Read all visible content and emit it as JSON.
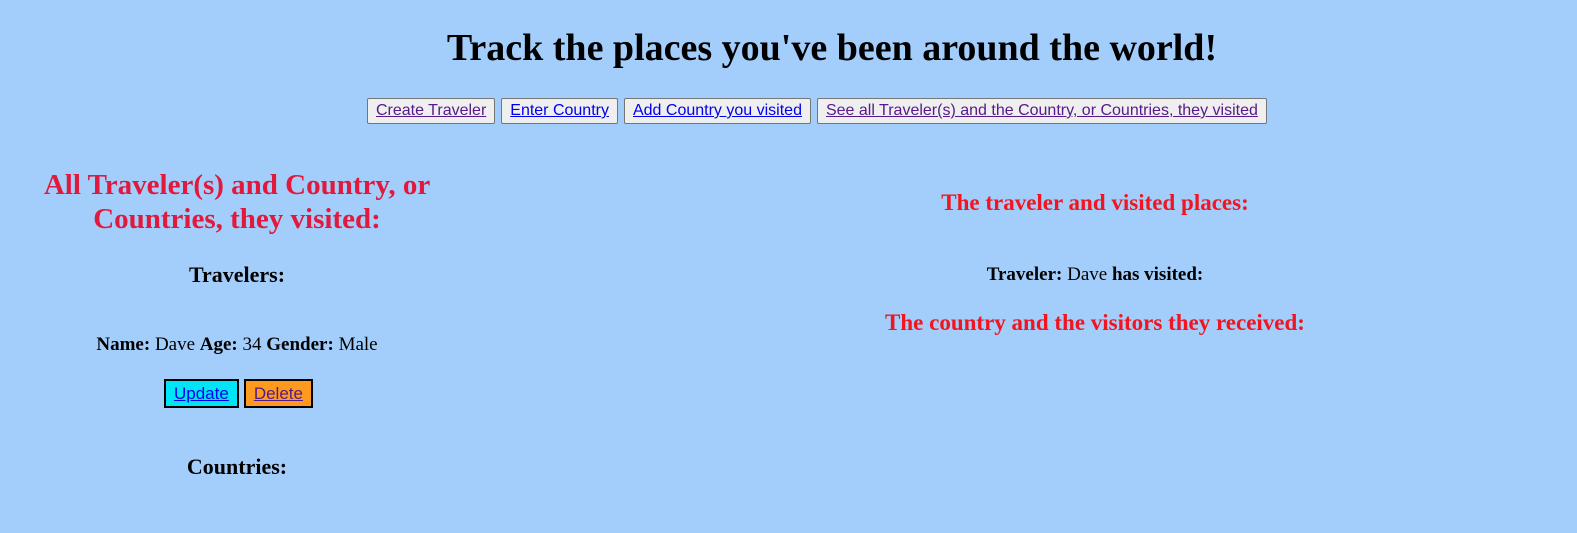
{
  "header": {
    "title": "Track the places you've been around the world!"
  },
  "nav": {
    "create_traveler": "Create Traveler",
    "enter_country": "Enter Country",
    "add_country_visited": "Add Country you visited",
    "see_all": "See all Traveler(s) and the Country, or Countries, they visited"
  },
  "left": {
    "title_line1": "All Traveler(s) and Country, or",
    "title_line2": "Countries, they visited:",
    "travelers_heading": "Travelers:",
    "traveler": {
      "name_label": "Name:",
      "name": "Dave",
      "age_label": "Age:",
      "age": "34",
      "gender_label": "Gender:",
      "gender": "Male"
    },
    "update_label": "Update",
    "delete_label": "Delete",
    "countries_heading": "Countries:"
  },
  "right": {
    "visited_title": "The traveler and visited places:",
    "traveler_label": "Traveler:",
    "traveler_name": "Dave",
    "has_visited_label": "has visited:",
    "visitors_title": "The country and the visitors they received:"
  },
  "colors": {
    "background": "#a3cefb",
    "left_title": "#e0193d",
    "right_title": "#f2141e",
    "update_button": "#00e5f5",
    "delete_button": "#ff9a1f"
  }
}
